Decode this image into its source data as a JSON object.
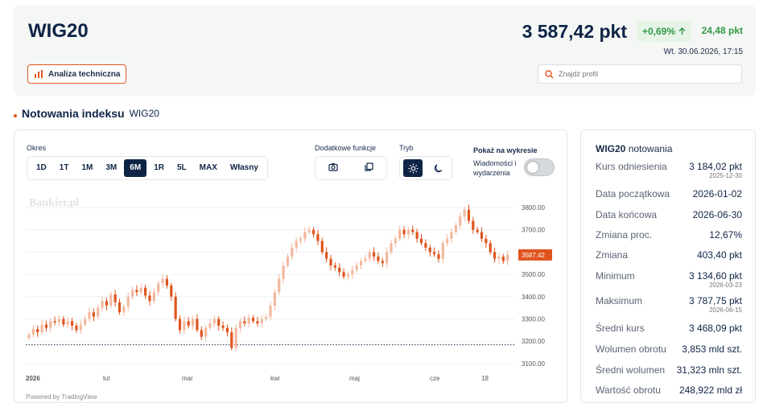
{
  "header": {
    "title": "WIG20",
    "price": "3 587,42 pkt",
    "change_pct": "+0,69%",
    "change_abs": "24,48 pkt",
    "datetime": "Wt. 30.06.2026, 17:15",
    "ta_button": "Analiza techniczna",
    "search_placeholder": "Znajdź profil"
  },
  "section": {
    "title": "Notowania indeksu",
    "subtitle": "WIG20"
  },
  "controls": {
    "period_label": "Okres",
    "periods": [
      "1D",
      "1T",
      "1M",
      "3M",
      "6M",
      "1R",
      "5L",
      "MAX",
      "Własny"
    ],
    "active_period": "6M",
    "functions_label": "Dodatkowe funkcje",
    "mode_label": "Tryb",
    "show_label": "Pokaż na wykresie",
    "news_label": "Wiadomości i wydarzenia"
  },
  "chart_data": {
    "type": "candlestick",
    "watermark": "Bankier.pl",
    "footer": "Powered by TradingView",
    "x_labels": [
      "2026",
      "lut",
      "mar",
      "kwi",
      "maj",
      "cze",
      "18"
    ],
    "y_ticks": [
      "3800.00",
      "3700.00",
      "3600.00",
      "3500.00",
      "3400.00",
      "3300.00",
      "3200.00",
      "3100.00"
    ],
    "ylim": [
      3100,
      3800
    ],
    "reference_level": 3184.02,
    "last_price_label": "3587.42",
    "up_color": "#f3b89e",
    "down_color": "#e0541f",
    "closes": [
      3230,
      3255,
      3240,
      3275,
      3260,
      3290,
      3285,
      3300,
      3275,
      3290,
      3270,
      3250,
      3275,
      3300,
      3330,
      3310,
      3350,
      3380,
      3360,
      3410,
      3375,
      3330,
      3355,
      3400,
      3430,
      3420,
      3440,
      3405,
      3380,
      3420,
      3460,
      3480,
      3450,
      3400,
      3300,
      3250,
      3290,
      3270,
      3300,
      3250,
      3220,
      3260,
      3280,
      3300,
      3270,
      3260,
      3240,
      3170,
      3260,
      3290,
      3280,
      3305,
      3290,
      3280,
      3300,
      3310,
      3360,
      3420,
      3480,
      3540,
      3580,
      3620,
      3650,
      3660,
      3690,
      3700,
      3680,
      3650,
      3600,
      3570,
      3540,
      3530,
      3510,
      3490,
      3500,
      3520,
      3540,
      3560,
      3570,
      3600,
      3580,
      3560,
      3550,
      3600,
      3640,
      3660,
      3700,
      3680,
      3700,
      3690,
      3660,
      3640,
      3620,
      3600,
      3590,
      3570,
      3640,
      3660,
      3690,
      3720,
      3760,
      3790,
      3740,
      3700,
      3690,
      3660,
      3640,
      3600,
      3570,
      3580,
      3560,
      3587.42
    ]
  },
  "stats": {
    "title_bold": "WIG20",
    "title_rest": "notowania",
    "rows": [
      {
        "label": "Kurs odniesienia",
        "value": "3 184,02 pkt",
        "sub": "2025-12-30"
      },
      {
        "label": "Data początkowa",
        "value": "2026-01-02"
      },
      {
        "label": "Data końcowa",
        "value": "2026-06-30"
      },
      {
        "label": "Zmiana proc.",
        "value": "12,67%"
      },
      {
        "label": "Zmiana",
        "value": "403,40 pkt"
      },
      {
        "label": "Minimum",
        "value": "3 134,60 pkt",
        "sub": "2026-03-23"
      },
      {
        "label": "Maksimum",
        "value": "3 787,75 pkt",
        "sub": "2026-06-15"
      },
      {
        "label": "Średni kurs",
        "value": "3 468,09 pkt"
      },
      {
        "label": "Wolumen obrotu",
        "value": "3,853 mld szt."
      },
      {
        "label": "Średni wolumen",
        "value": "31,323 mln szt."
      },
      {
        "label": "Wartość obrotu",
        "value": "248,922 mld zł"
      }
    ]
  },
  "colors": {
    "accent": "#e0541f",
    "navy": "#0e2446",
    "green": "#2f9a45"
  }
}
